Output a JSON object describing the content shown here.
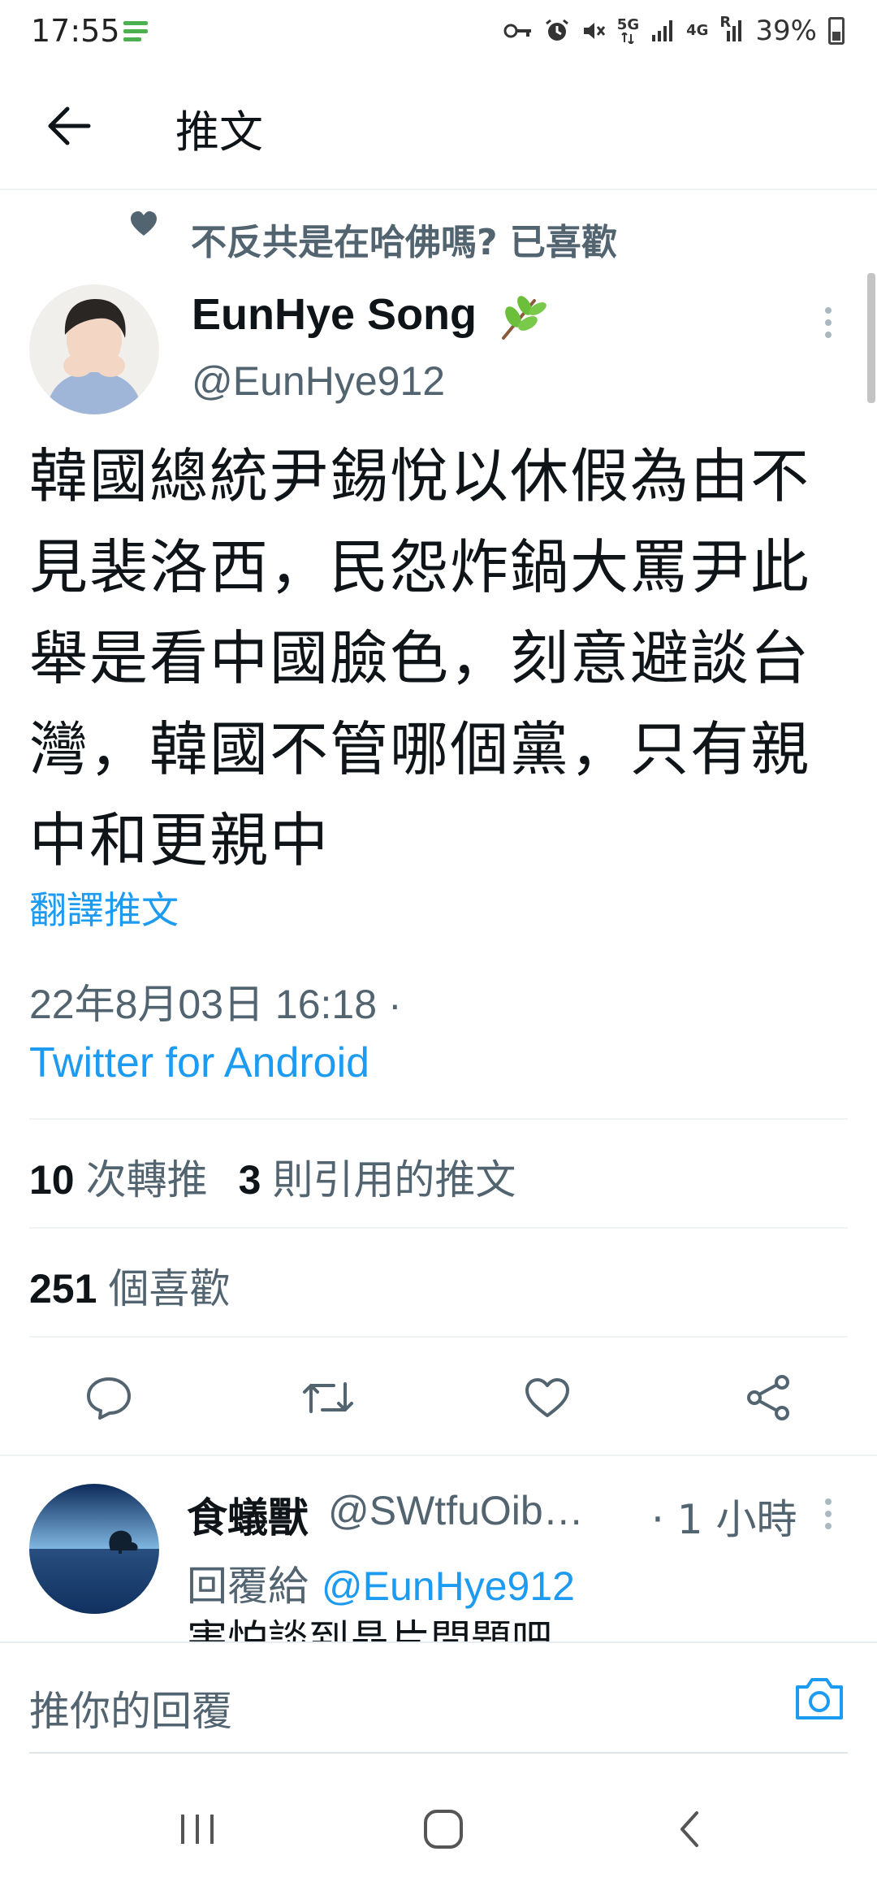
{
  "status_bar": {
    "time": "17:55",
    "network_5g": "5G",
    "network_4g": "4G",
    "roaming": "R",
    "battery": "39%"
  },
  "header": {
    "title": "推文"
  },
  "liked_context": {
    "text": "不反共是在哈佛嗎? 已喜歡"
  },
  "tweet": {
    "author_name": "EunHye Song",
    "author_handle": "@EunHye912",
    "text": "韓國總統尹錫悅以休假為由不見裴洛西，民怨炸鍋大罵尹此舉是看中國臉色，刻意避談台灣，韓國不管哪個黨，只有親中和更親中",
    "translate_label": "翻譯推文",
    "timestamp": "22年8月03日 16:18 ·",
    "source": "Twitter for Android",
    "retweets_count": "10",
    "retweets_label": "次轉推",
    "quotes_count": "3",
    "quotes_label": "則引用的推文",
    "likes_count": "251",
    "likes_label": "個喜歡"
  },
  "reply": {
    "name": "食蟻獸",
    "handle": "@SWtfuOib…",
    "time": "· 1 小時",
    "reply_to_prefix": "回覆給 ",
    "reply_to_handle": "@EunHye912",
    "text": "害怕談到晶片問題吧"
  },
  "compose": {
    "placeholder": "推你的回覆"
  },
  "colors": {
    "accent": "#1d9bf0",
    "secondary_text": "#536471",
    "primary_text": "#0f1419"
  }
}
